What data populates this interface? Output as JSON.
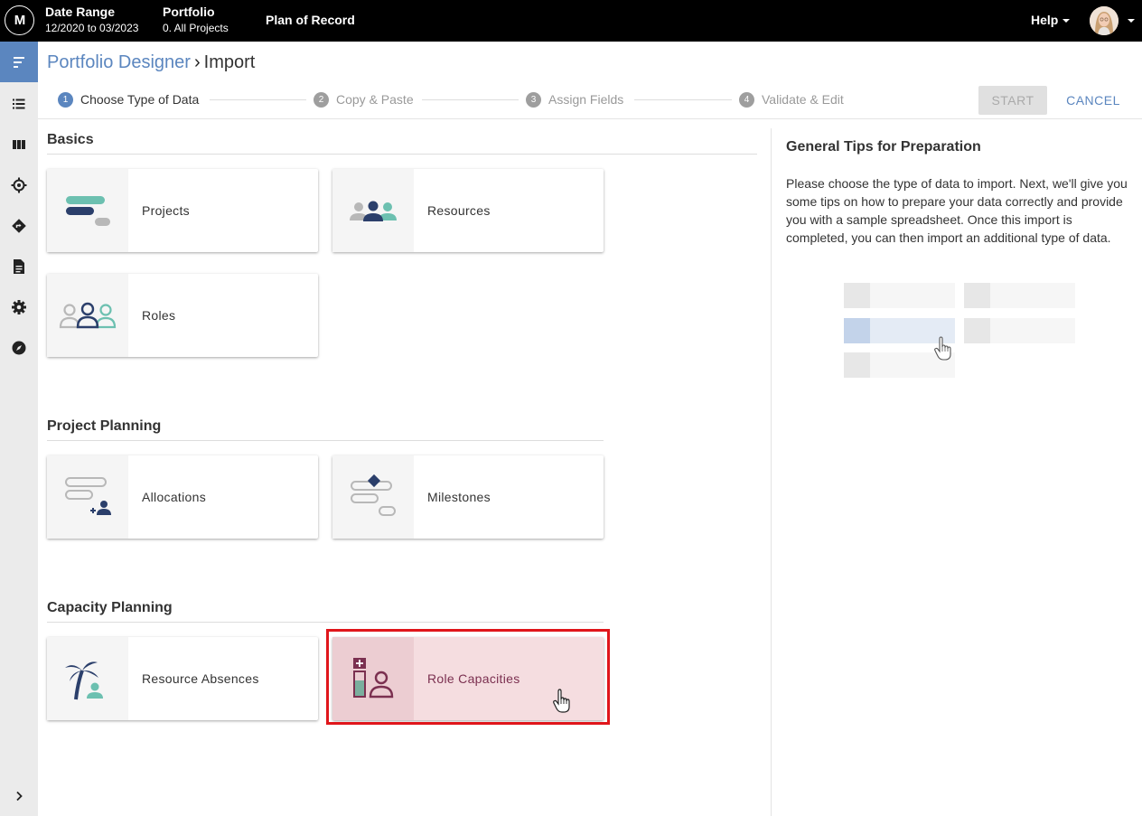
{
  "topbar": {
    "logo_text": "M",
    "date_range_label": "Date Range",
    "date_range_value": "12/2020 to 03/2023",
    "portfolio_label": "Portfolio",
    "portfolio_value": "0. All Projects",
    "plan_label": "Plan of Record",
    "help_label": "Help"
  },
  "rail": {
    "items": [
      "menu-icon",
      "list-icon",
      "columns-icon",
      "target-icon",
      "directions-icon",
      "document-icon",
      "gear-icon",
      "compass-icon"
    ],
    "expand_icon": "chevron-right-icon",
    "active_color": "#5b86bf"
  },
  "breadcrumb": {
    "parent": "Portfolio Designer",
    "separator": "›",
    "current": "Import"
  },
  "steps": [
    {
      "num": "1",
      "label": "Choose Type of Data",
      "active": true
    },
    {
      "num": "2",
      "label": "Copy & Paste",
      "active": false
    },
    {
      "num": "3",
      "label": "Assign Fields",
      "active": false
    },
    {
      "num": "4",
      "label": "Validate & Edit",
      "active": false
    }
  ],
  "actions": {
    "start_label": "START",
    "cancel_label": "CANCEL"
  },
  "sections": {
    "basics": {
      "title": "Basics",
      "cards": {
        "projects": "Projects",
        "resources": "Resources",
        "roles": "Roles"
      }
    },
    "project_planning": {
      "title": "Project Planning",
      "cards": {
        "allocations": "Allocations",
        "milestones": "Milestones"
      }
    },
    "capacity_planning": {
      "title": "Capacity Planning",
      "cards": {
        "resource_absences": "Resource Absences",
        "role_capacities": "Role Capacities"
      }
    }
  },
  "tips": {
    "title": "General Tips for Preparation",
    "body": "Please choose the type of data to import. Next, we'll give you some tips on how to prepare your data correctly and provide you with a sample spreadsheet. Once this import is completed, you can then import an additional type of data."
  },
  "colors": {
    "accent": "#5b86bf",
    "navy": "#2b3f6b",
    "teal": "#6cc0b0",
    "gray": "#b8b8b8",
    "selected_bg": "#f5dde0",
    "selected_text": "#7b3050",
    "highlight": "#e0161b"
  }
}
